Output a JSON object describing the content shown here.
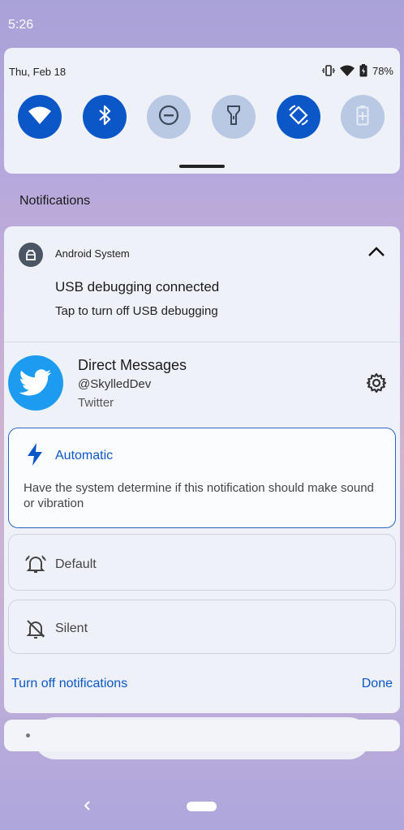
{
  "status_bar": {
    "time": "5:26"
  },
  "quick_settings": {
    "date": "Thu, Feb 18",
    "battery": "78%",
    "tiles": [
      {
        "icon": "wifi-icon",
        "state": "on"
      },
      {
        "icon": "bluetooth-icon",
        "state": "on"
      },
      {
        "icon": "do-not-disturb-icon",
        "state": "off"
      },
      {
        "icon": "flashlight-icon",
        "state": "off"
      },
      {
        "icon": "auto-rotate-icon",
        "state": "on"
      },
      {
        "icon": "battery-saver-icon",
        "state": "off"
      }
    ]
  },
  "notifications": {
    "header": "Notifications",
    "system": {
      "app": "Android System",
      "title": "USB debugging connected",
      "text": "Tap to turn off USB debugging"
    },
    "channel": {
      "title": "Direct Messages",
      "handle": "@SkylledDev",
      "app": "Twitter",
      "options": {
        "automatic": {
          "label": "Automatic",
          "description": "Have the system determine if this notification should make sound or vibration",
          "selected": true
        },
        "default": {
          "label": "Default"
        },
        "silent": {
          "label": "Silent"
        }
      },
      "turn_off_label": "Turn off notifications",
      "done_label": "Done"
    }
  },
  "colors": {
    "accent": "#0b57c8",
    "tile_on": "#0b57c8",
    "tile_off": "#b9c9e4",
    "twitter": "#1d9bf0"
  }
}
